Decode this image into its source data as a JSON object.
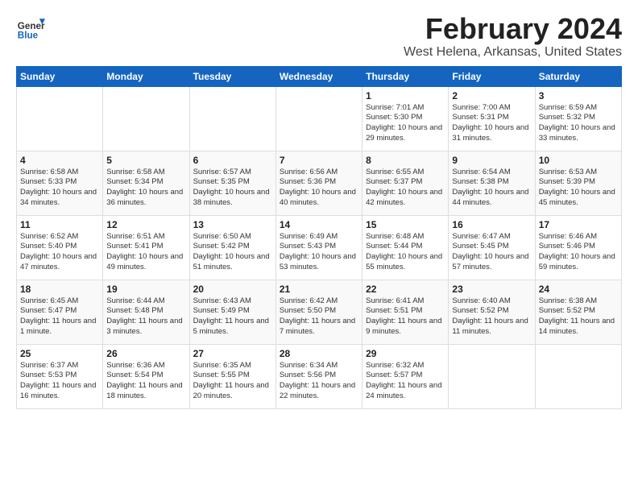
{
  "header": {
    "logo_general": "General",
    "logo_blue": "Blue",
    "month": "February 2024",
    "location": "West Helena, Arkansas, United States"
  },
  "columns": [
    "Sunday",
    "Monday",
    "Tuesday",
    "Wednesday",
    "Thursday",
    "Friday",
    "Saturday"
  ],
  "weeks": [
    [
      {
        "day": "",
        "info": ""
      },
      {
        "day": "",
        "info": ""
      },
      {
        "day": "",
        "info": ""
      },
      {
        "day": "",
        "info": ""
      },
      {
        "day": "1",
        "info": "Sunrise: 7:01 AM\nSunset: 5:30 PM\nDaylight: 10 hours\nand 29 minutes."
      },
      {
        "day": "2",
        "info": "Sunrise: 7:00 AM\nSunset: 5:31 PM\nDaylight: 10 hours\nand 31 minutes."
      },
      {
        "day": "3",
        "info": "Sunrise: 6:59 AM\nSunset: 5:32 PM\nDaylight: 10 hours\nand 33 minutes."
      }
    ],
    [
      {
        "day": "4",
        "info": "Sunrise: 6:58 AM\nSunset: 5:33 PM\nDaylight: 10 hours\nand 34 minutes."
      },
      {
        "day": "5",
        "info": "Sunrise: 6:58 AM\nSunset: 5:34 PM\nDaylight: 10 hours\nand 36 minutes."
      },
      {
        "day": "6",
        "info": "Sunrise: 6:57 AM\nSunset: 5:35 PM\nDaylight: 10 hours\nand 38 minutes."
      },
      {
        "day": "7",
        "info": "Sunrise: 6:56 AM\nSunset: 5:36 PM\nDaylight: 10 hours\nand 40 minutes."
      },
      {
        "day": "8",
        "info": "Sunrise: 6:55 AM\nSunset: 5:37 PM\nDaylight: 10 hours\nand 42 minutes."
      },
      {
        "day": "9",
        "info": "Sunrise: 6:54 AM\nSunset: 5:38 PM\nDaylight: 10 hours\nand 44 minutes."
      },
      {
        "day": "10",
        "info": "Sunrise: 6:53 AM\nSunset: 5:39 PM\nDaylight: 10 hours\nand 45 minutes."
      }
    ],
    [
      {
        "day": "11",
        "info": "Sunrise: 6:52 AM\nSunset: 5:40 PM\nDaylight: 10 hours\nand 47 minutes."
      },
      {
        "day": "12",
        "info": "Sunrise: 6:51 AM\nSunset: 5:41 PM\nDaylight: 10 hours\nand 49 minutes."
      },
      {
        "day": "13",
        "info": "Sunrise: 6:50 AM\nSunset: 5:42 PM\nDaylight: 10 hours\nand 51 minutes."
      },
      {
        "day": "14",
        "info": "Sunrise: 6:49 AM\nSunset: 5:43 PM\nDaylight: 10 hours\nand 53 minutes."
      },
      {
        "day": "15",
        "info": "Sunrise: 6:48 AM\nSunset: 5:44 PM\nDaylight: 10 hours\nand 55 minutes."
      },
      {
        "day": "16",
        "info": "Sunrise: 6:47 AM\nSunset: 5:45 PM\nDaylight: 10 hours\nand 57 minutes."
      },
      {
        "day": "17",
        "info": "Sunrise: 6:46 AM\nSunset: 5:46 PM\nDaylight: 10 hours\nand 59 minutes."
      }
    ],
    [
      {
        "day": "18",
        "info": "Sunrise: 6:45 AM\nSunset: 5:47 PM\nDaylight: 11 hours\nand 1 minute."
      },
      {
        "day": "19",
        "info": "Sunrise: 6:44 AM\nSunset: 5:48 PM\nDaylight: 11 hours\nand 3 minutes."
      },
      {
        "day": "20",
        "info": "Sunrise: 6:43 AM\nSunset: 5:49 PM\nDaylight: 11 hours\nand 5 minutes."
      },
      {
        "day": "21",
        "info": "Sunrise: 6:42 AM\nSunset: 5:50 PM\nDaylight: 11 hours\nand 7 minutes."
      },
      {
        "day": "22",
        "info": "Sunrise: 6:41 AM\nSunset: 5:51 PM\nDaylight: 11 hours\nand 9 minutes."
      },
      {
        "day": "23",
        "info": "Sunrise: 6:40 AM\nSunset: 5:52 PM\nDaylight: 11 hours\nand 11 minutes."
      },
      {
        "day": "24",
        "info": "Sunrise: 6:38 AM\nSunset: 5:52 PM\nDaylight: 11 hours\nand 14 minutes."
      }
    ],
    [
      {
        "day": "25",
        "info": "Sunrise: 6:37 AM\nSunset: 5:53 PM\nDaylight: 11 hours\nand 16 minutes."
      },
      {
        "day": "26",
        "info": "Sunrise: 6:36 AM\nSunset: 5:54 PM\nDaylight: 11 hours\nand 18 minutes."
      },
      {
        "day": "27",
        "info": "Sunrise: 6:35 AM\nSunset: 5:55 PM\nDaylight: 11 hours\nand 20 minutes."
      },
      {
        "day": "28",
        "info": "Sunrise: 6:34 AM\nSunset: 5:56 PM\nDaylight: 11 hours\nand 22 minutes."
      },
      {
        "day": "29",
        "info": "Sunrise: 6:32 AM\nSunset: 5:57 PM\nDaylight: 11 hours\nand 24 minutes."
      },
      {
        "day": "",
        "info": ""
      },
      {
        "day": "",
        "info": ""
      }
    ]
  ]
}
